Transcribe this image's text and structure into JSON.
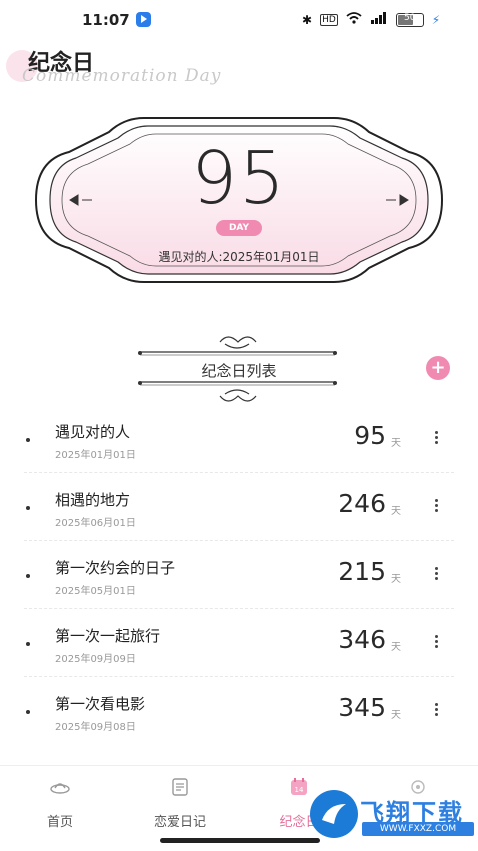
{
  "status_bar": {
    "time": "11:07",
    "battery": "50"
  },
  "header": {
    "title": "纪念日",
    "subtitle": "Commemoration Day"
  },
  "hero": {
    "days": "95",
    "day_badge": "DAY",
    "description": "遇见对的人:2025年01月01日"
  },
  "list_section": {
    "title": "纪念日列表",
    "add_label": "+"
  },
  "anniversaries": [
    {
      "name": "遇见对的人",
      "date": "2025年01月01日",
      "days": "95",
      "unit": "天"
    },
    {
      "name": "相遇的地方",
      "date": "2025年06月01日",
      "days": "246",
      "unit": "天"
    },
    {
      "name": "第一次约会的日子",
      "date": "2025年05月01日",
      "days": "215",
      "unit": "天"
    },
    {
      "name": "第一次一起旅行",
      "date": "2025年09月09日",
      "days": "346",
      "unit": "天"
    },
    {
      "name": "第一次看电影",
      "date": "2025年09月08日",
      "days": "345",
      "unit": "天"
    }
  ],
  "bottom_nav": {
    "items": [
      {
        "label": "首页",
        "icon": "home-icon"
      },
      {
        "label": "恋爱日记",
        "icon": "diary-icon"
      },
      {
        "label": "纪念日",
        "icon": "calendar-icon",
        "active": true
      },
      {
        "label": "",
        "icon": "profile-icon"
      }
    ]
  },
  "watermark": {
    "text": "飞翔下载",
    "url": "WWW.FXXZ.COM"
  },
  "colors": {
    "accent": "#f08ab0",
    "active_tab": "#e56f9a",
    "frame_fill": "#fdeef3"
  }
}
